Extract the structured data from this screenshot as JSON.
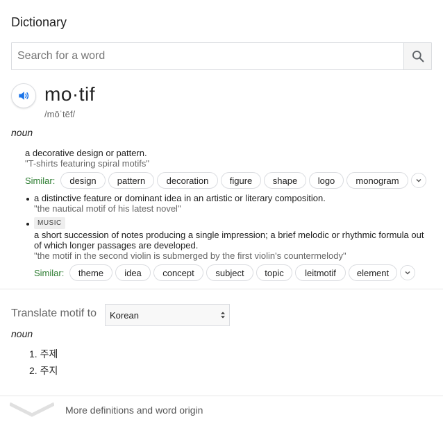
{
  "header": {
    "title": "Dictionary"
  },
  "search": {
    "placeholder": "Search for a word",
    "button_icon": "search-icon"
  },
  "entry": {
    "word": "mo·tif",
    "phonetic": "/mōˈtēf/",
    "part_of_speech": "noun",
    "sense1": {
      "definition": "a decorative design or pattern.",
      "example": "\"T-shirts featuring spiral motifs\"",
      "similar_label": "Similar:",
      "similar": [
        "design",
        "pattern",
        "decoration",
        "figure",
        "shape",
        "logo",
        "monogram"
      ]
    },
    "sense2": {
      "definition": "a distinctive feature or dominant idea in an artistic or literary composition.",
      "example": "\"the nautical motif of his latest novel\""
    },
    "sense3": {
      "tag": "MUSIC",
      "definition_line1": "a short succession of notes producing a single impression; a brief melodic or rhythmic formula out",
      "definition_line2": "of which longer passages are developed.",
      "example": "\"the motif in the second violin is submerged by the first violin's countermelody\"",
      "similar_label": "Similar:",
      "similar": [
        "theme",
        "idea",
        "concept",
        "subject",
        "topic",
        "leitmotif",
        "element"
      ]
    }
  },
  "translate": {
    "label": "Translate motif to",
    "language": "Korean",
    "part_of_speech": "noun",
    "items": [
      "1. 주제",
      "2. 주지"
    ]
  },
  "footer": {
    "more_label": "More definitions and word origin"
  },
  "colors": {
    "similar_label": "#2e7d32",
    "speaker_icon": "#1a73e8"
  }
}
